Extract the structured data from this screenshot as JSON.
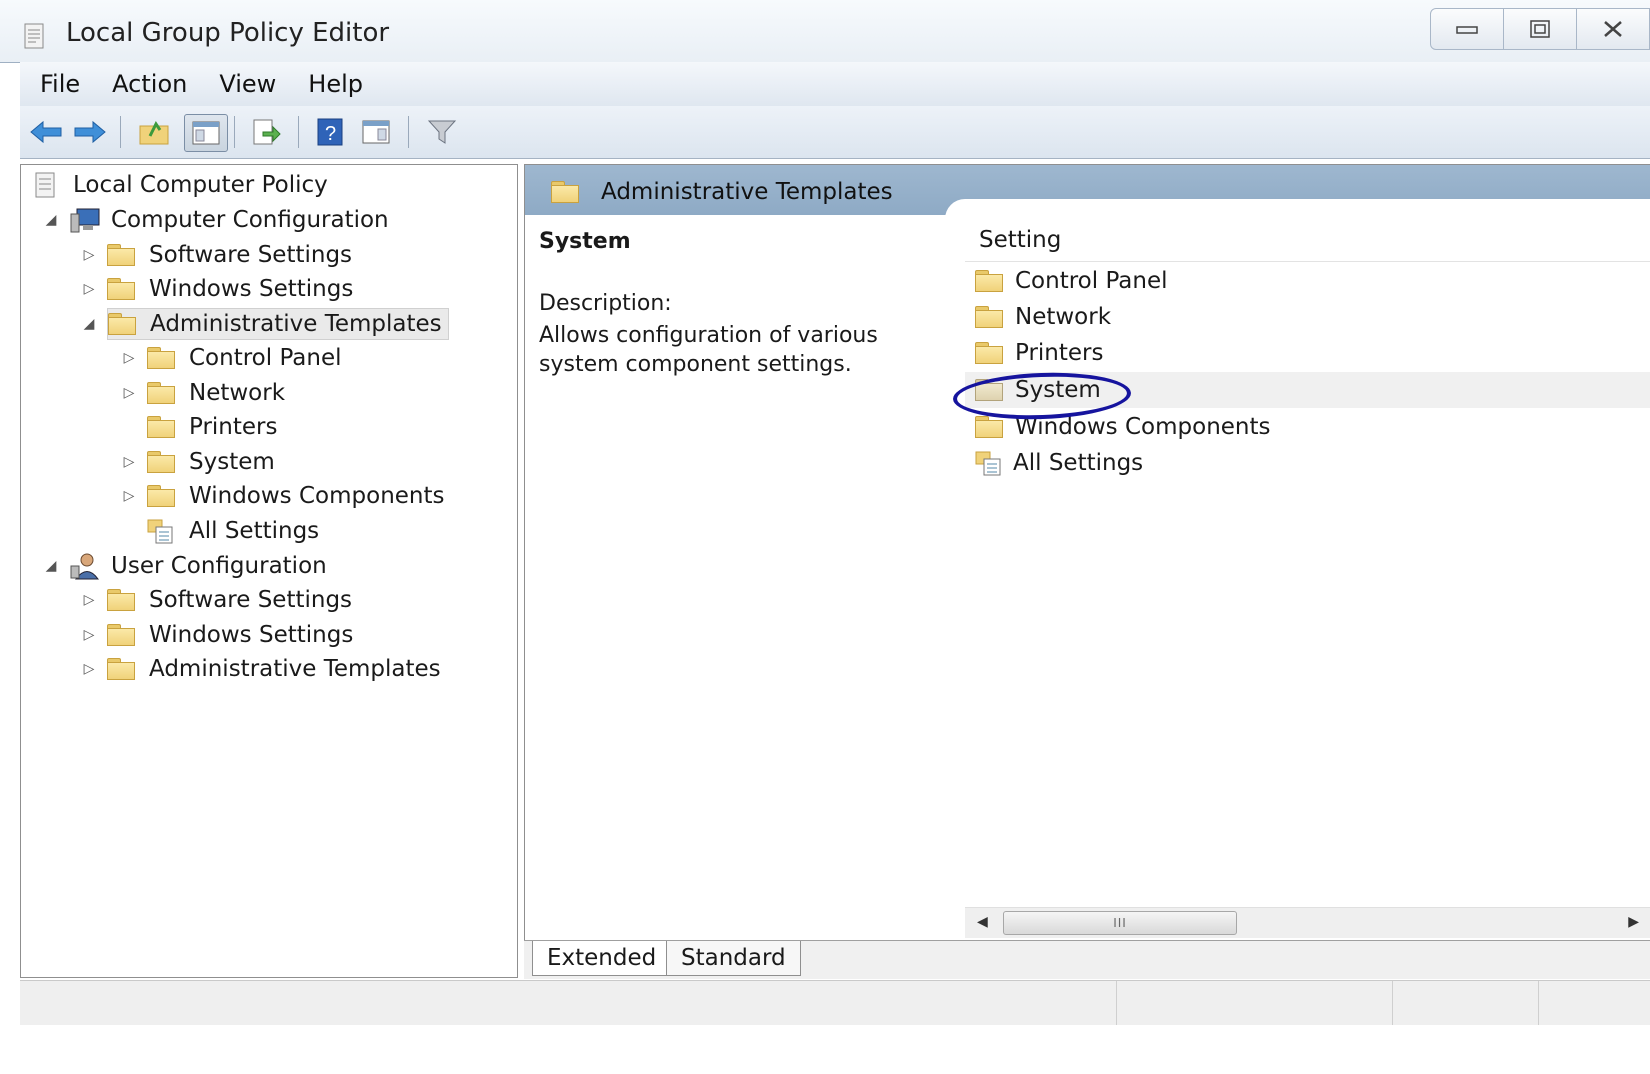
{
  "window": {
    "title": "Local Group Policy Editor"
  },
  "menu": [
    "File",
    "Action",
    "View",
    "Help"
  ],
  "tree": {
    "root": "Local Computer Policy",
    "computer_config": "Computer Configuration",
    "cc_software": "Software Settings",
    "cc_windows": "Windows Settings",
    "cc_admin": "Administrative Templates",
    "at_control_panel": "Control Panel",
    "at_network": "Network",
    "at_printers": "Printers",
    "at_system": "System",
    "at_windows_components": "Windows Components",
    "at_all_settings": "All Settings",
    "user_config": "User Configuration",
    "uc_software": "Software Settings",
    "uc_windows": "Windows Settings",
    "uc_admin": "Administrative Templates"
  },
  "details": {
    "header": "Administrative Templates",
    "selected_title": "System",
    "description_label": "Description:",
    "description_text": "Allows configuration of various system component settings.",
    "column_header": "Setting",
    "items": [
      "Control Panel",
      "Network",
      "Printers",
      "System",
      "Windows Components",
      "All Settings"
    ],
    "scroll_thumb": "III"
  },
  "tabs": [
    "Extended",
    "Standard"
  ],
  "colors": {
    "header_band": "#9eb7cf",
    "annotation_circle": "#16149e",
    "folder": "#f0d27a"
  }
}
